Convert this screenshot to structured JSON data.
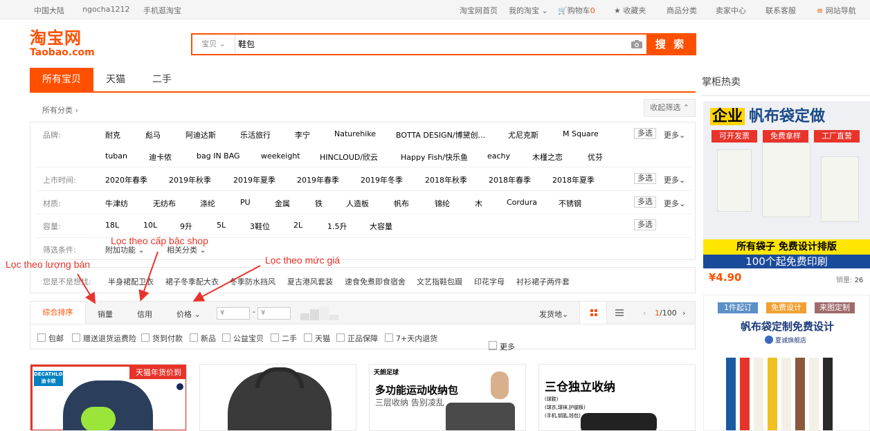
{
  "topbar": {
    "region": "中国大陆",
    "user": "ngocha1212",
    "mobile": "手机逛淘宝",
    "home": "淘宝网首页",
    "my_taobao": "我的淘宝",
    "cart_label": "购物车",
    "cart_count": "0",
    "favorites": "收藏夹",
    "categories": "商品分类",
    "seller": "卖家中心",
    "service": "联系客服",
    "site_nav": "网站导航"
  },
  "logo": {
    "cn": "淘宝网",
    "en": "Taobao.com"
  },
  "search": {
    "category": "宝贝",
    "query": "鞋包",
    "button": "搜 索"
  },
  "tabs": [
    "所有宝贝",
    "天猫",
    "二手"
  ],
  "catbar": {
    "all": "所有分类",
    "fold": "收起筛选"
  },
  "filters": {
    "brand": {
      "label": "品牌:",
      "row1": [
        "耐克",
        "彪马",
        "阿迪达斯",
        "乐活旅行",
        "李宁",
        "Naturehike",
        "BOTTA DESIGN/博黛创...",
        "尤尼克斯",
        "M Square"
      ],
      "row2": [
        "tuban",
        "迪卡侬",
        "bag IN BAG",
        "weekeight",
        "HINCLOUD/欣云",
        "Happy Fish/快乐鱼",
        "eachy",
        "木槿之恋",
        "优芬"
      ]
    },
    "time": {
      "label": "上市时间:",
      "options": [
        "2020年春季",
        "2019年秋季",
        "2019年夏季",
        "2019年春季",
        "2019年冬季",
        "2018年秋季",
        "2018年春季",
        "2018年夏季"
      ]
    },
    "material": {
      "label": "材质:",
      "options": [
        "牛津纺",
        "无纺布",
        "涤纶",
        "PU",
        "金属",
        "铁",
        "人造板",
        "帆布",
        "锦纶",
        "木",
        "Cordura",
        "不锈钢"
      ]
    },
    "capacity": {
      "label": "容量:",
      "options": [
        "18L",
        "10L",
        "9升",
        "5L",
        "3鞋位",
        "2L",
        "1.5升",
        "大容量"
      ]
    },
    "conditions": {
      "label": "筛选条件:",
      "options": [
        "附加功能",
        "相关分类"
      ]
    },
    "multi": "多选",
    "more": "更多"
  },
  "guess": {
    "label": "您是不是想找:",
    "items": [
      "半身裙配卫衣",
      "裙子冬季配大衣",
      "冬季防水挡风",
      "夏古港风套装",
      "速食免煮即食宿舍",
      "文艺指鞋包蹑",
      "印花字母",
      "衬衫裙子两件套"
    ]
  },
  "sort": {
    "items": [
      "综合排序",
      "销量",
      "信用",
      "价格"
    ],
    "price_from": "¥",
    "price_to": "¥",
    "ship_from": "发货地",
    "page": "1/100"
  },
  "checks": [
    "包邮",
    "赠送退货运费险",
    "货到付款",
    "新品",
    "公益宝贝",
    "二手",
    "天猫",
    "正品保障",
    "7+天内退货"
  ],
  "checks_more": "更多",
  "annotations": {
    "sales": "Lọc theo lượng bán",
    "shop": "Lọc theo cấp bậc shop",
    "price": "Lọc theo mức giá"
  },
  "cards": [
    {
      "brand": "DECATHLON",
      "brand_cn": "迪卡侬",
      "banner": "天猫年货价到"
    },
    {
      "brand": "",
      "brand_cn": "",
      "banner": ""
    },
    {
      "brand": "天朗足球",
      "brand_cn": "",
      "banner": "多功能运动收纳包",
      "sub": "三层收纳 告别凌乱"
    },
    {
      "brand": "",
      "brand_cn": "",
      "banner": "三仓独立收纳",
      "sub": "(球鞋)\n(球衣,球袜,护腿板)\n(手机,钥匙,钱包)"
    }
  ],
  "side": {
    "title": "掌柜热卖",
    "ad1": {
      "headline_a": "企业",
      "headline_b": "帆布袋定做",
      "tags": [
        "可开发票",
        "免费拿样",
        "工厂直营"
      ],
      "bar1": "所有袋子 免费设计排版",
      "bar2": "100个起免费印刷",
      "price": "¥4.90",
      "sold_label": "销量:",
      "sold": "26"
    },
    "ad2": {
      "tags": [
        "1件起订",
        "免费设计",
        "来图定制"
      ],
      "headline": "帆布袋定制免费设计",
      "shop": "夏诚旗舰店"
    }
  },
  "colors": {
    "accent": "#ff5000",
    "annotation": "#e8332a"
  }
}
